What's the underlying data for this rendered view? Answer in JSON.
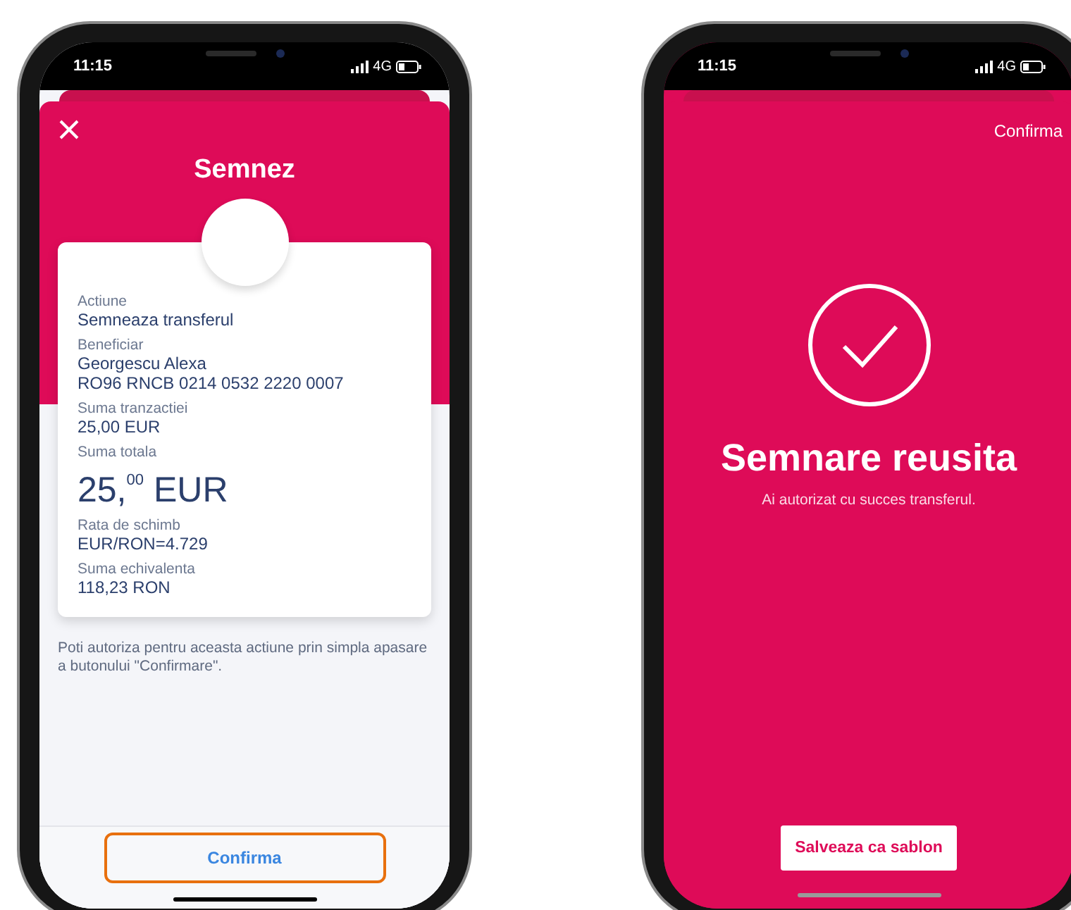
{
  "phones": [
    {
      "kind": "sign",
      "status": {
        "time": "11:15",
        "network": "4G"
      },
      "title": "Semnez",
      "fields": [
        {
          "kind": "normal",
          "label": "Actiune",
          "values": [
            "Semneaza transferul"
          ]
        },
        {
          "kind": "normal",
          "label": "Beneficiar",
          "values": [
            "Georgescu Alexa",
            "RO96 RNCB 0214 0532 2220 0007"
          ]
        },
        {
          "kind": "normal",
          "label": "Suma tranzactiei",
          "values": [
            "25,00 EUR"
          ]
        },
        {
          "kind": "big",
          "label": "Suma totala",
          "values": [
            "25,$^{00}$ EUR"
          ]
        },
        {
          "kind": "normal",
          "label": "Rata de schimb",
          "values": [
            "EUR/RON=4.729"
          ]
        },
        {
          "kind": "normal",
          "label": "Suma echivalenta",
          "values": [
            "118,23 RON"
          ]
        }
      ],
      "note": "Poti autoriza pentru aceasta actiune prin simpla apasare a butonului \"Confirmare\".",
      "button": {
        "label": "Confirma",
        "highlighted": true
      }
    },
    {
      "kind": "success",
      "status": {
        "time": "11:15",
        "network": "4G"
      },
      "link": "Confirma",
      "title": "Semnare reusita",
      "subtitle": "Ai autorizat cu succes transferul.",
      "button": {
        "label": "Salveaza ca sablon",
        "highlighted": false
      }
    }
  ]
}
